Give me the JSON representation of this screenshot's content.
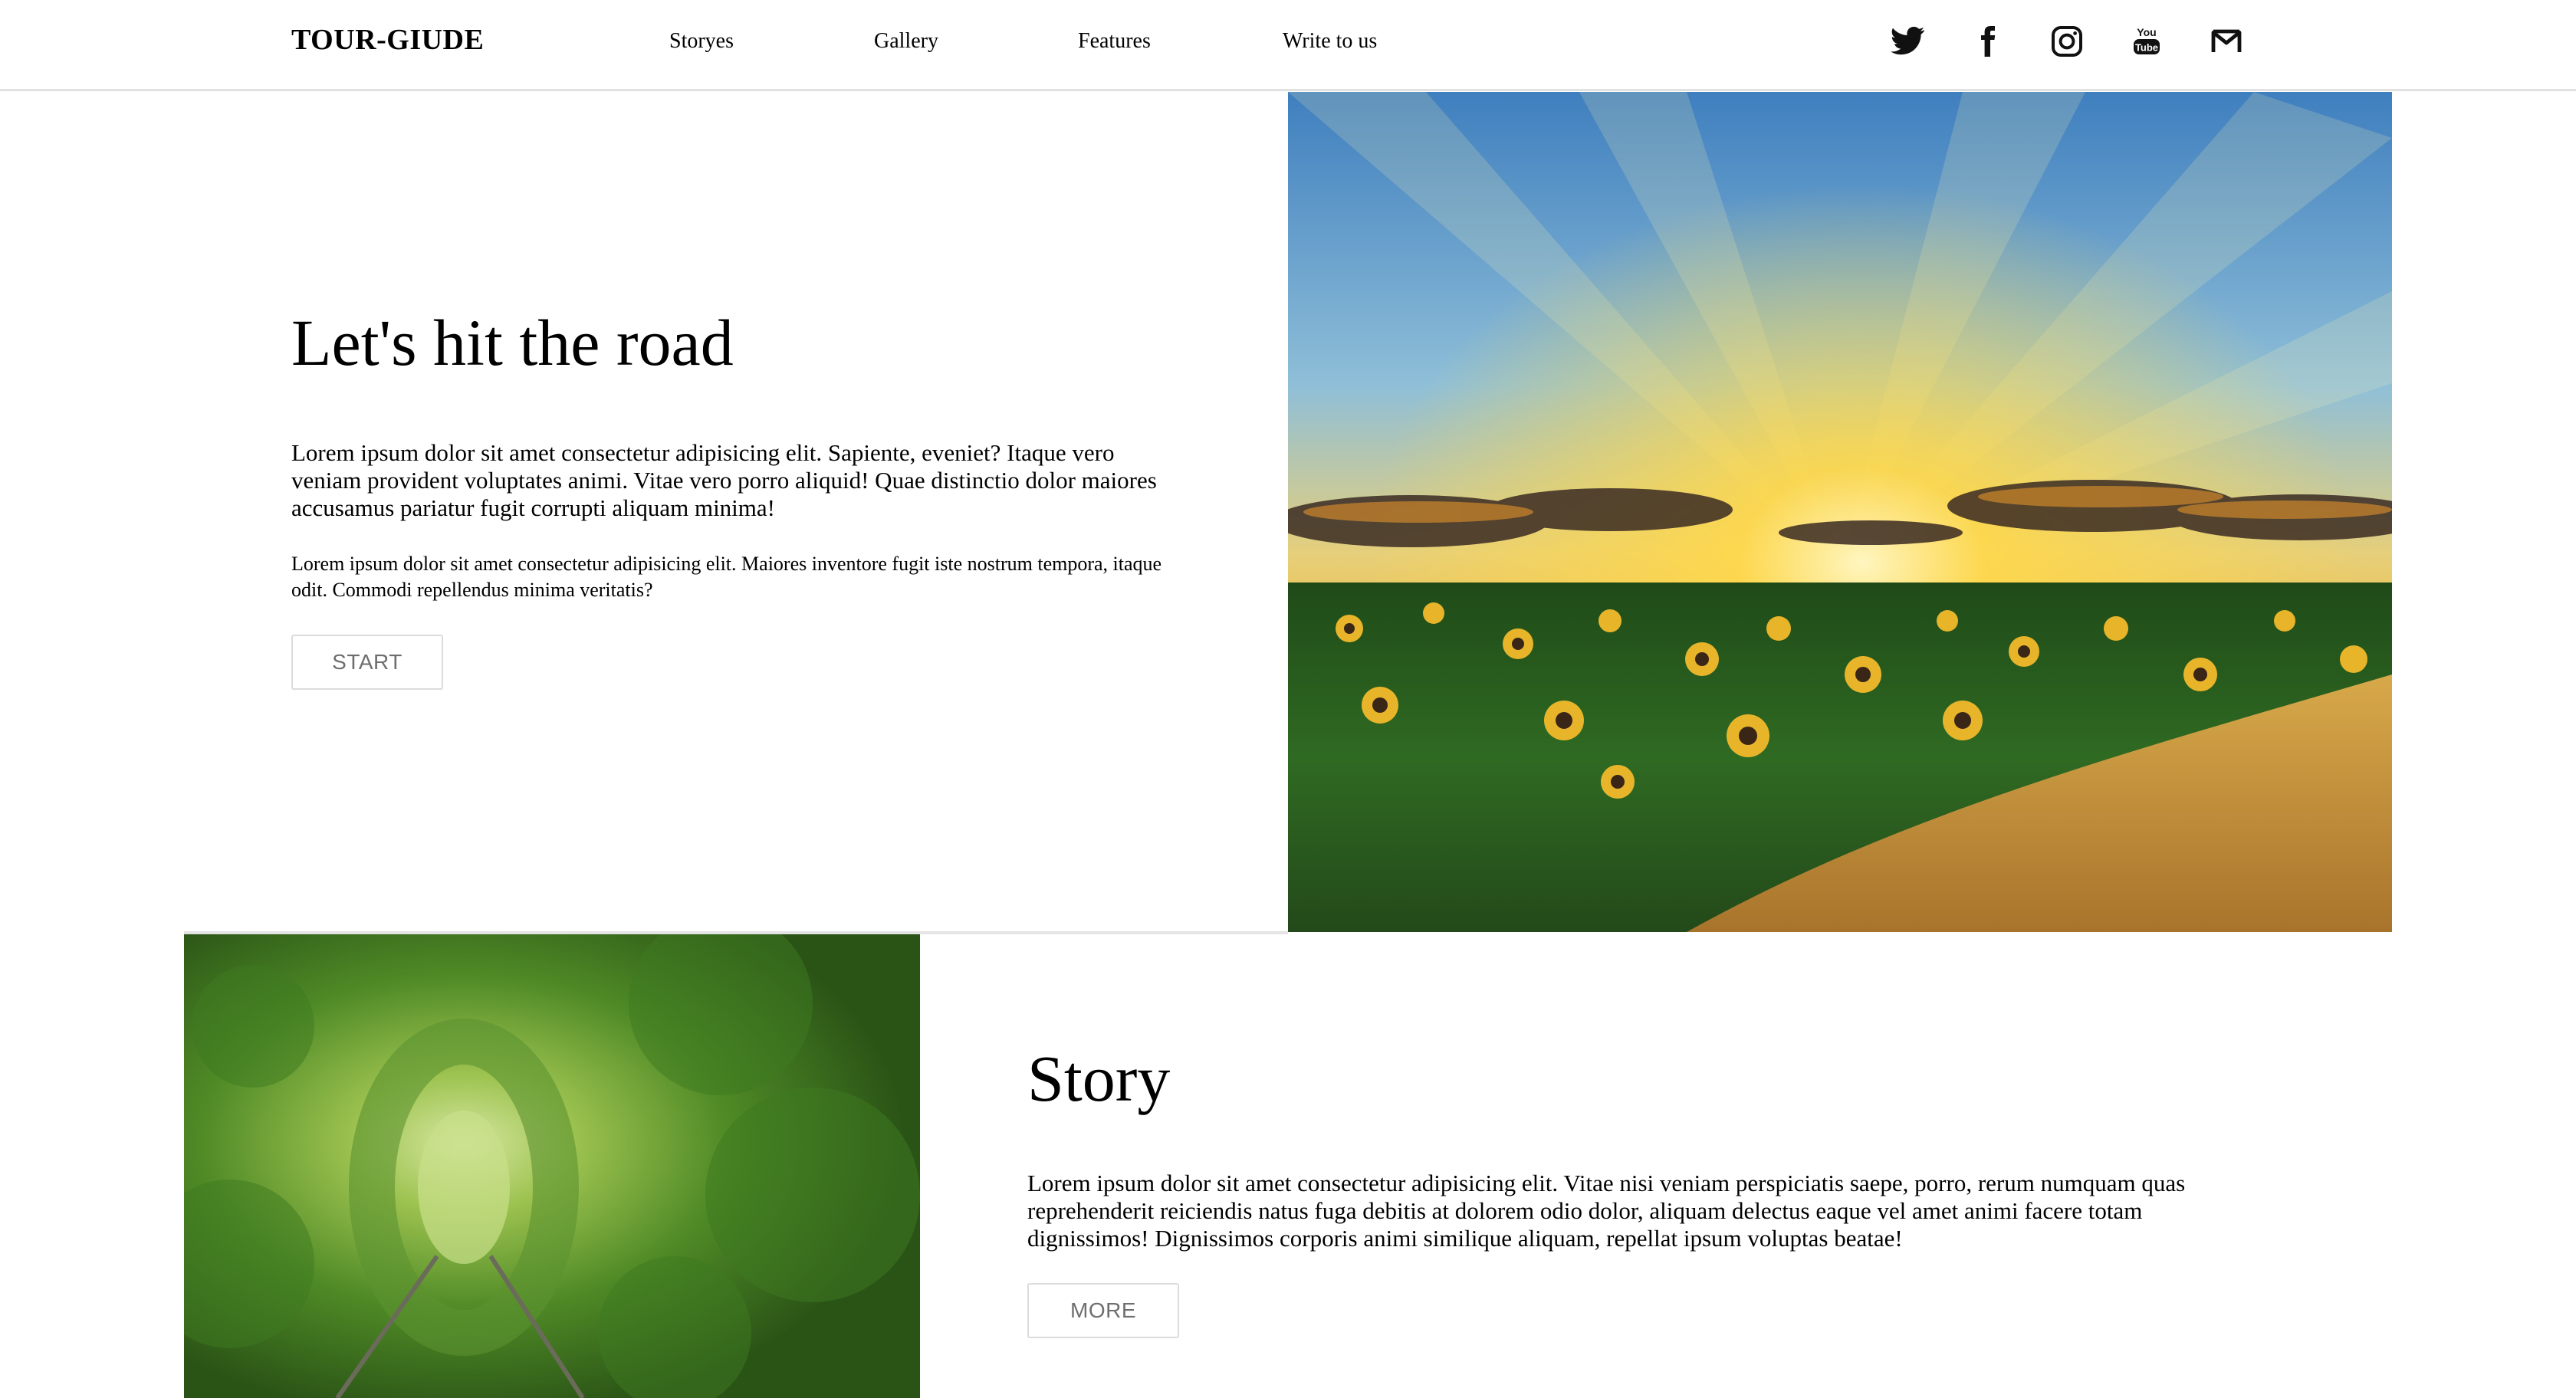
{
  "header": {
    "logo": "TOUR-GIUDE",
    "nav": [
      {
        "label": "Storyes"
      },
      {
        "label": "Gallery"
      },
      {
        "label": "Features"
      },
      {
        "label": "Write to us"
      }
    ],
    "social": [
      "twitter-icon",
      "facebook-icon",
      "instagram-icon",
      "youtube-icon",
      "mail-icon"
    ]
  },
  "hero": {
    "title": "Let's hit the road",
    "paragraph1": "Lorem ipsum dolor sit amet consectetur adipisicing elit. Sapiente, eveniet? Itaque vero veniam provident voluptates animi. Vitae vero porro aliquid! Quae distinctio dolor maiores accusamus pariatur fugit corrupti aliquam minima!",
    "paragraph2": "Lorem ipsum dolor sit amet consectetur adipisicing elit. Maiores inventore fugit iste nostrum tempora, itaque odit. Commodi repellendus minima veritatis?",
    "button": "START"
  },
  "story": {
    "title": "Story",
    "paragraph": "Lorem ipsum dolor sit amet consectetur adipisicing elit. Vitae nisi veniam perspiciatis saepe, porro, rerum numquam quas reprehenderit reiciendis natus fuga debitis at dolorem odio dolor, aliquam delectus eaque vel amet animi facere totam dignissimos! Dignissimos corporis animi similique aliquam, repellat ipsum voluptas beatae!",
    "button": "MORE"
  },
  "colors": {
    "border": "#e2e2e2",
    "button_text": "#6e6e6e"
  }
}
